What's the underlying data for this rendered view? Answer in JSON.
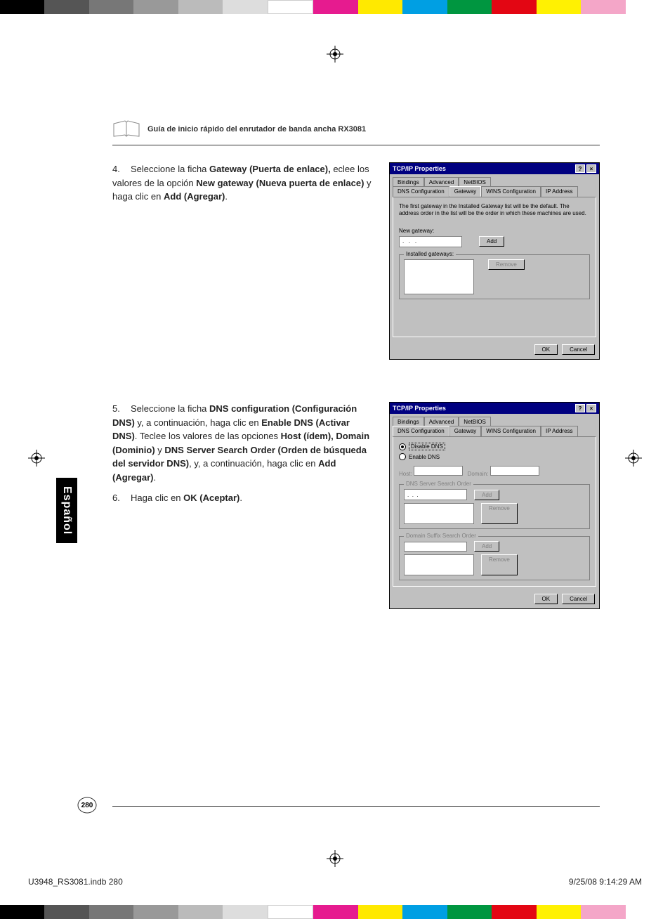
{
  "colorbar_top": [
    "#000",
    "#555",
    "#777",
    "#999",
    "#bbb",
    "#ddd",
    "#fff",
    "#e61b8f",
    "#ffe900",
    "#009fe3",
    "#009640",
    "#e30613",
    "#fff102",
    "#f4a6c8",
    "#fff"
  ],
  "colorbar_bottom": [
    "#000",
    "#555",
    "#777",
    "#999",
    "#bbb",
    "#ddd",
    "#fff",
    "#e61b8f",
    "#ffe900",
    "#009fe3",
    "#009640",
    "#e30613",
    "#fff102",
    "#f4a6c8",
    "#fff"
  ],
  "header_title": "Guía de inicio rápido del enrutador de banda ancha RX3081",
  "step4": {
    "num": "4.",
    "t1": "Seleccione la ficha ",
    "b1": "Gateway (Puerta de enlace),",
    "t2": " eclee los valores de la opción ",
    "b2": "New gateway (Nueva puerta de enlace)",
    "t3": " y haga clic en ",
    "b3": "Add (Agregar)",
    "t4": "."
  },
  "step5": {
    "num": "5.",
    "t1": "Seleccione la ficha ",
    "b1": "DNS configuration (Configuración DNS)",
    "t2": " y, a continuación, haga clic en ",
    "b2": "Enable DNS (Activar DNS)",
    "t3": ". Teclee los valores de las opciones ",
    "b3": "Host (ídem), Domain (Dominio)",
    "t4": " y ",
    "b4": "DNS Server Search Order (Orden de búsqueda del servidor DNS)",
    "t5": ", y, a continuación, haga clic en ",
    "b5": "Add (Agregar)",
    "t6": "."
  },
  "step6": {
    "num": "6.",
    "t1": "Haga clic en ",
    "b1": "OK (Aceptar)",
    "t2": "."
  },
  "dialog1": {
    "title": "TCP/IP Properties",
    "help": "?",
    "close": "×",
    "tabs_top": [
      "Bindings",
      "Advanced",
      "NetBIOS"
    ],
    "tabs_bot": [
      "DNS Configuration",
      "Gateway",
      "WINS Configuration",
      "IP Address"
    ],
    "selected_tab": "Gateway",
    "info": "The first gateway in the Installed Gateway list will be the default. The address order in the list will be the order in which these machines are used.",
    "new_gw_label": "New gateway:",
    "ip_sep": ".",
    "add_btn": "Add",
    "installed_label": "Installed gateways:",
    "remove_btn": "Remove",
    "ok": "OK",
    "cancel": "Cancel"
  },
  "dialog2": {
    "title": "TCP/IP Properties",
    "help": "?",
    "close": "×",
    "tabs_top": [
      "Bindings",
      "Advanced",
      "NetBIOS"
    ],
    "tabs_bot": [
      "DNS Configuration",
      "Gateway",
      "WINS Configuration",
      "IP Address"
    ],
    "selected_tab": "DNS Configuration",
    "disable_dns": "Disable DNS",
    "enable_dns": "Enable DNS",
    "host_label": "Host:",
    "domain_label": "Domain:",
    "dns_order_label": "DNS Server Search Order",
    "suffix_label": "Domain Suffix Search Order",
    "add_btn": "Add",
    "remove_btn": "Remove",
    "ok": "OK",
    "cancel": "Cancel"
  },
  "lang_tab": "Español",
  "page_num": "280",
  "footer_left": "U3948_RS3081.indb   280",
  "footer_right": "9/25/08   9:14:29 AM"
}
